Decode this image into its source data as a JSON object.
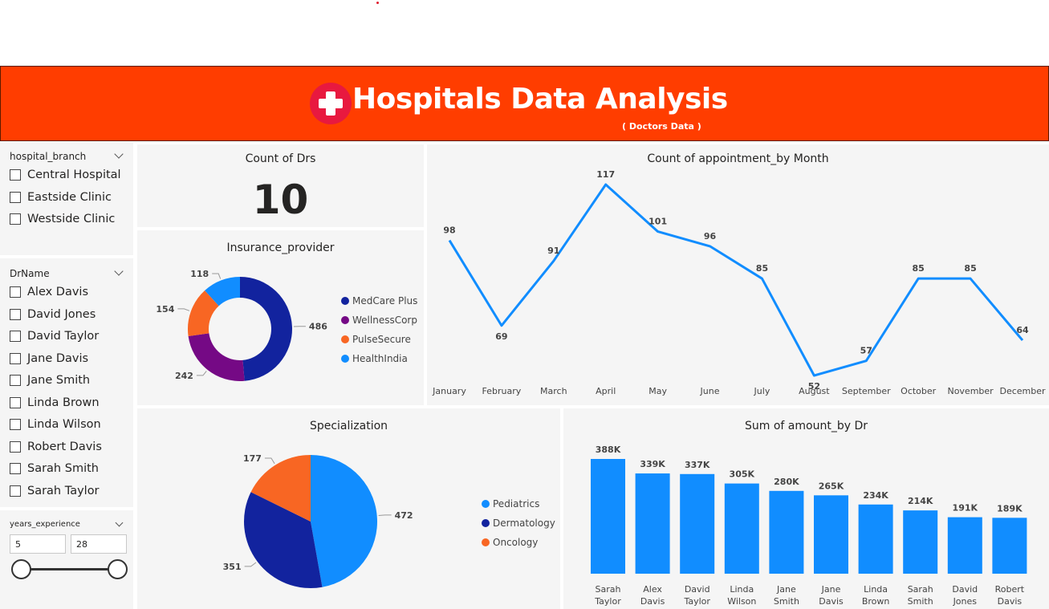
{
  "header": {
    "title": "Hospitals Data Analysis",
    "subtitle": "( Doctors Data )"
  },
  "colors": {
    "banner": "#ff3d00",
    "logo": "#e8193f",
    "accent_blue": "#118dff",
    "dark_blue": "#12239e",
    "purple": "#750985",
    "orange": "#f86623",
    "navy": "#0f2a9e"
  },
  "slicers": {
    "branch": {
      "title": "hospital_branch",
      "options": [
        "Central Hospital",
        "Eastside Clinic",
        "Westside Clinic"
      ]
    },
    "doctor": {
      "title": "DrName",
      "options": [
        "Alex Davis",
        "David Jones",
        "David Taylor",
        "Jane Davis",
        "Jane Smith",
        "Linda Brown",
        "Linda Wilson",
        "Robert Davis",
        "Sarah Smith",
        "Sarah Taylor"
      ]
    },
    "experience": {
      "title": "years_experience",
      "min": "5",
      "max": "28"
    }
  },
  "kpi": {
    "title": "Count of Drs",
    "value": "10"
  },
  "insurance": {
    "title": "Insurance_provider",
    "legend": [
      "MedCare Plus",
      "WellnessCorp",
      "PulseSecure",
      "HealthIndia"
    ]
  },
  "specialization": {
    "title": "Specialization",
    "legend": [
      "Pediatrics",
      "Dermatology",
      "Oncology"
    ]
  },
  "appointments": {
    "title": "Count of appointment_by Month"
  },
  "amount": {
    "title": "Sum of amount_by Dr"
  },
  "chart_data": [
    {
      "type": "pie",
      "title": "Insurance_provider",
      "categories": [
        "MedCare Plus",
        "WellnessCorp",
        "PulseSecure",
        "HealthIndia"
      ],
      "values": [
        486,
        242,
        154,
        118
      ],
      "colors": [
        "#12239e",
        "#750985",
        "#f86623",
        "#118dff"
      ],
      "donut": true,
      "legend": "right"
    },
    {
      "type": "line",
      "title": "Count of appointment_by Month",
      "categories": [
        "January",
        "February",
        "March",
        "April",
        "May",
        "June",
        "July",
        "August",
        "September",
        "October",
        "November",
        "December"
      ],
      "values": [
        98,
        69,
        91,
        117,
        101,
        96,
        85,
        52,
        57,
        85,
        85,
        64
      ],
      "color": "#118dff",
      "grid": false
    },
    {
      "type": "pie",
      "title": "Specialization",
      "categories": [
        "Pediatrics",
        "Dermatology",
        "Oncology"
      ],
      "values": [
        472,
        351,
        177
      ],
      "colors": [
        "#118dff",
        "#12239e",
        "#f86623"
      ],
      "legend": "right"
    },
    {
      "type": "bar",
      "title": "Sum of amount_by Dr",
      "categories": [
        "Sarah Taylor",
        "Alex Davis",
        "David Taylor",
        "Linda Wilson",
        "Jane Smith",
        "Jane Davis",
        "Linda Brown",
        "Sarah Smith",
        "David Jones",
        "Robert Davis"
      ],
      "values": [
        388,
        339,
        337,
        305,
        280,
        265,
        234,
        214,
        191,
        189
      ],
      "labels": [
        "388K",
        "339K",
        "337K",
        "305K",
        "280K",
        "265K",
        "234K",
        "214K",
        "191K",
        "189K"
      ],
      "color": "#118dff"
    }
  ]
}
